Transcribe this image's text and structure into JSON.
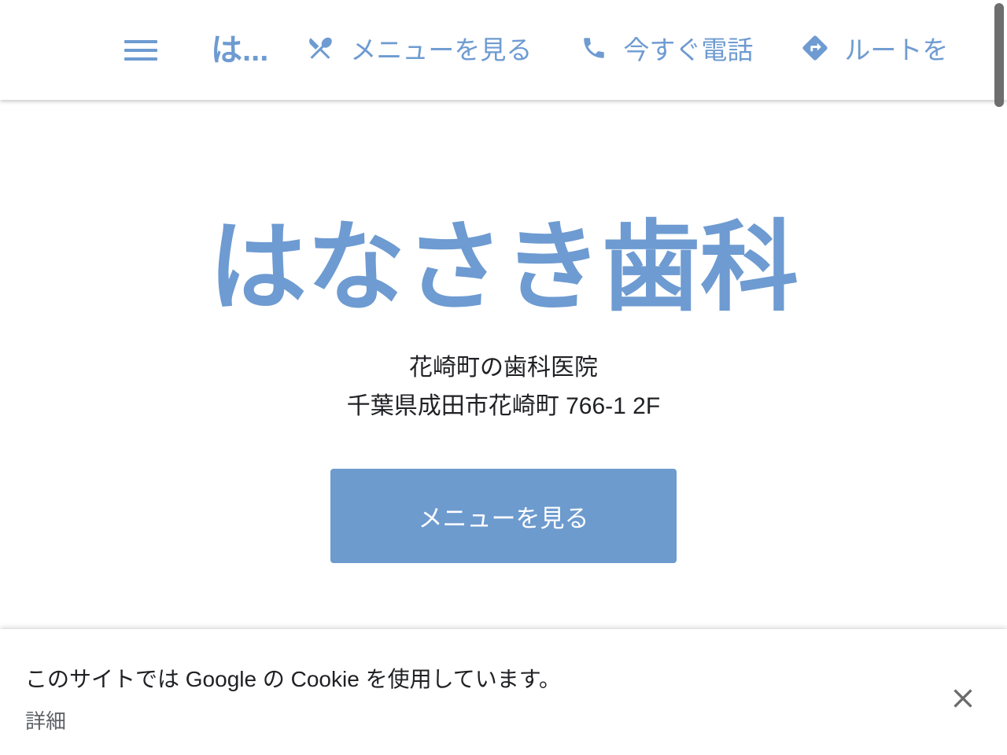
{
  "site": {
    "brand_truncated": "は...",
    "hero_title": "はなさき歯科",
    "hero_subtitle_line1": "花崎町の歯科医院",
    "hero_subtitle_line2": "千葉県成田市花崎町 766-1 2F",
    "cta_label": "メニューを見る"
  },
  "nav": {
    "menu_icon_name": "hamburger-icon",
    "items": [
      {
        "label": "メニューを見る",
        "icon": "restaurant-icon"
      },
      {
        "label": "今すぐ電話",
        "icon": "phone-icon"
      },
      {
        "label": "ルートを",
        "icon": "directions-icon"
      }
    ]
  },
  "cookie_banner": {
    "message": "このサイトでは Google の Cookie を使用しています。",
    "details_label": "詳細",
    "close_icon": "close-icon"
  },
  "colors": {
    "brand_blue": "#6e9bd1",
    "button_blue": "#6d9bce",
    "text_dark": "#202124",
    "text_grey": "#5f6368",
    "scrollbar": "#6e6e6e",
    "background": "#ffffff"
  }
}
